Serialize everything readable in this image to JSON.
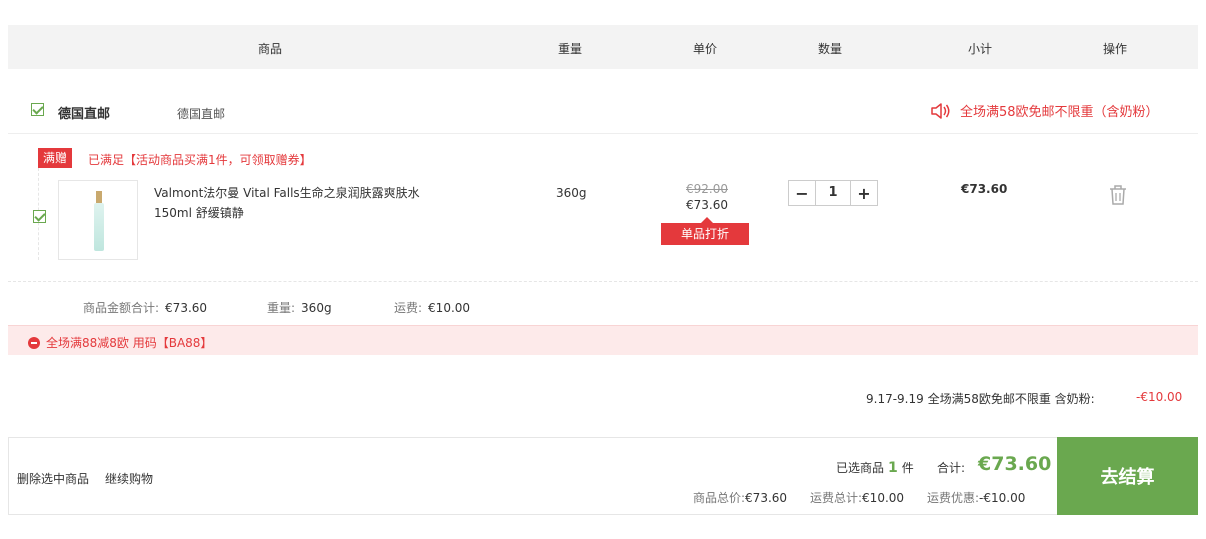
{
  "table_header": {
    "product": "商品",
    "weight": "重量",
    "unit_price": "单价",
    "quantity": "数量",
    "subtotal": "小计",
    "action": "操作"
  },
  "store": {
    "name": "德国直邮",
    "subtitle": "德国直邮",
    "shipping_promo": "全场满58欧免邮不限重（含奶粉）"
  },
  "gift": {
    "tag": "满赠",
    "text": "已满足【活动商品买满1件，可领取赠券】"
  },
  "item": {
    "name": "Valmont法尔曼 Vital Falls生命之泉润肤露爽肤水150ml 舒缓镇静",
    "weight": "360g",
    "original_price": "€92.00",
    "price": "€73.60",
    "discount_tag": "单品打折",
    "quantity": "1",
    "subtotal": "€73.60"
  },
  "store_summary": {
    "amount_label": "商品金额合计:",
    "amount": "€73.60",
    "weight_label": "重量:",
    "weight": "360g",
    "shipping_label": "运费:",
    "shipping": "€10.00"
  },
  "coupon": {
    "text": "全场满88减8欧 用码【BA88】"
  },
  "promotion": {
    "text": "9.17-9.19 全场满58欧免邮不限重 含奶粉:",
    "amount": "-€10.00"
  },
  "footer": {
    "delete_selected": "删除选中商品",
    "continue_shopping": "继续购物",
    "selected_prefix": "已选商品",
    "selected_count": "1",
    "selected_suffix": "件",
    "total_label": "合计:",
    "total": "€73.60",
    "goods_total_label": "商品总价:",
    "goods_total": "€73.60",
    "shipping_total_label": "运费总计:",
    "shipping_total": "€10.00",
    "shipping_discount_label": "运费优惠:",
    "shipping_discount": "-€10.00",
    "checkout": "去结算"
  },
  "colors": {
    "accent_green": "#6aa84f",
    "accent_red": "#e4393c"
  }
}
